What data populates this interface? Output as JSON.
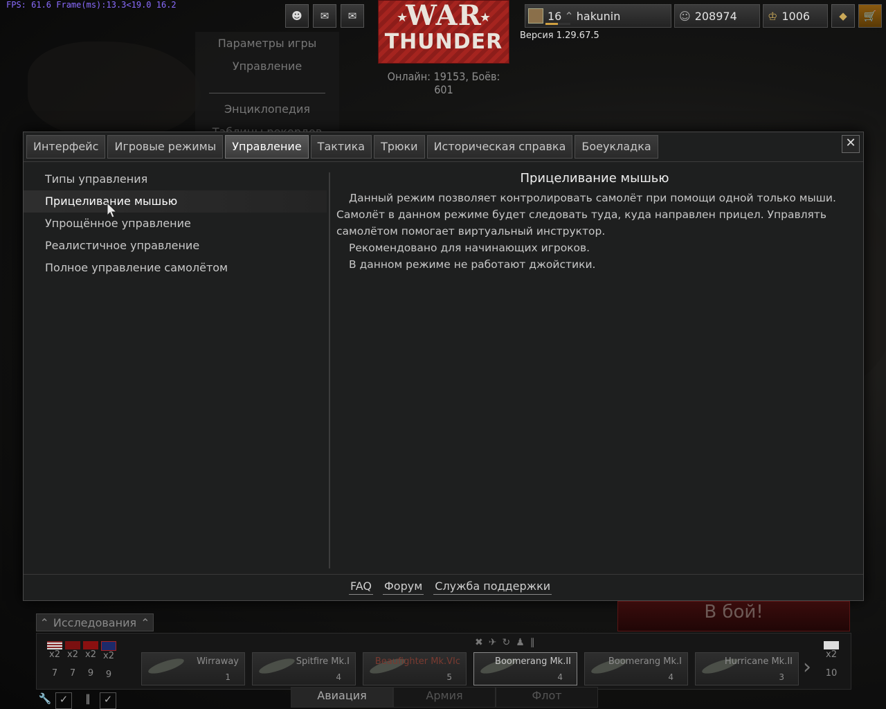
{
  "fps": "FPS: 61.6 Frame(ms):13.3<19.0 16.2",
  "logo": {
    "line1": "WAR",
    "line2": "THUNDER"
  },
  "online": "Онлайн: 19153, Боёв: 601",
  "version": "Версия 1.29.67.5",
  "player": {
    "rank": "16",
    "name": "hakunin",
    "silver": "208974",
    "gold": "1006"
  },
  "background_menu": [
    "Параметры игры",
    "Управление",
    "Энциклопедия",
    "Таблицы рекордов"
  ],
  "tabs": [
    "Интерфейс",
    "Игровые режимы",
    "Управление",
    "Тактика",
    "Трюки",
    "Историческая справка",
    "Боеукладка"
  ],
  "active_tab": "Управление",
  "left_items": [
    "Типы управления",
    "Прицеливание мышью",
    "Упрощённое управление",
    "Реалистичное управление",
    "Полное управление самолётом"
  ],
  "content": {
    "title": "Прицеливание мышью",
    "paragraphs": [
      "Данный режим позволяет контролировать самолёт при помощи одной только мыши. Самолёт в данном режиме будет следовать туда, куда направлен прицел. Управлять самолётом помогает виртуальный инструктор.",
      "Рекомендовано для начинающих игроков.",
      "В данном режиме не работают джойстики."
    ]
  },
  "footer_links": [
    "FAQ",
    "Форум",
    "Служба поддержки"
  ],
  "battle_button": "В бой!",
  "research_label": "Исследования",
  "flags": [
    {
      "mult": "x2",
      "num": "7"
    },
    {
      "mult": "x2",
      "num": "7"
    },
    {
      "mult": "x2",
      "num": "9"
    },
    {
      "mult": "x2",
      "num": "9"
    },
    {
      "mult": "x2",
      "num": "10"
    }
  ],
  "aircraft": [
    {
      "name": "Wirraway",
      "rank": "1"
    },
    {
      "name": "Spitfire Mk.I",
      "rank": "4"
    },
    {
      "name": "Beaufighter Mk.VIc",
      "rank": "5"
    },
    {
      "name": "Boomerang Mk.II",
      "rank": "4"
    },
    {
      "name": "Boomerang Mk.I",
      "rank": "4"
    },
    {
      "name": "Hurricane Mk.II",
      "rank": "3"
    }
  ],
  "bottom_tabs": [
    "Авиация",
    "Армия",
    "Флот"
  ],
  "colors": {
    "accent_red": "#a5241f",
    "fps_text": "#8a6cff"
  }
}
